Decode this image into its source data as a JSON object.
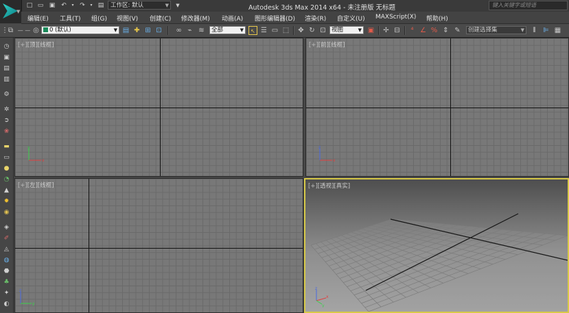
{
  "window": {
    "title": "Autodesk 3ds Max  2014 x64  - 未注册版   无标题",
    "workspace_label": "工作区: 默认",
    "search_placeholder": "键入关键字或短语"
  },
  "menu": [
    "编辑(E)",
    "工具(T)",
    "组(G)",
    "视图(V)",
    "创建(C)",
    "修改器(M)",
    "动画(A)",
    "图形编辑器(D)",
    "渲染(R)",
    "自定义(U)",
    "MAXScript(X)",
    "帮助(H)"
  ],
  "toolbar": {
    "layer_value": "0 (默认)",
    "filter_value": "全部",
    "ref_coord_value": "视图",
    "selection_set_placeholder": "创建选择集"
  },
  "viewports": [
    {
      "id": "top",
      "bracket": "[+]",
      "name": "[顶]",
      "shading": "[线框]"
    },
    {
      "id": "front",
      "bracket": "[+]",
      "name": "[前]",
      "shading": "[线框]"
    },
    {
      "id": "left",
      "bracket": "[+]",
      "name": "[左]",
      "shading": "[线框]"
    },
    {
      "id": "perspective",
      "bracket": "[+]",
      "name": "[透视]",
      "shading": "[真实]"
    }
  ],
  "colors": {
    "active_viewport_border": "#d7c948",
    "axis_x": "#e04040",
    "axis_y": "#3ad04a",
    "axis_z": "#4a6ae0"
  }
}
